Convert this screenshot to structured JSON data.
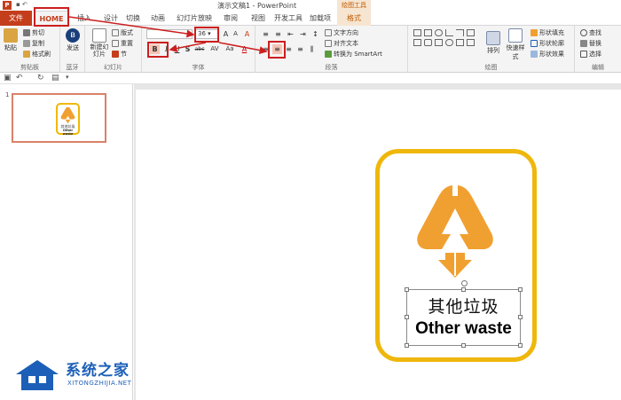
{
  "window": {
    "title": "演示文稿1 - PowerPoint",
    "contextual_tools_label": "绘图工具"
  },
  "tabs": [
    {
      "label": "文件"
    },
    {
      "label": "HOME"
    },
    {
      "label": "插入"
    },
    {
      "label": "设计"
    },
    {
      "label": "切换"
    },
    {
      "label": "动画"
    },
    {
      "label": "幻灯片放映"
    },
    {
      "label": "审阅"
    },
    {
      "label": "视图"
    },
    {
      "label": "开发工具"
    },
    {
      "label": "加载项"
    },
    {
      "label": "格式"
    }
  ],
  "ribbon": {
    "clipboard": {
      "label": "剪贴板",
      "paste": "粘贴",
      "cut": "剪切",
      "copy": "复制",
      "format_painter": "格式刷"
    },
    "bluetooth": {
      "label": "蓝牙",
      "send": "发送"
    },
    "slides": {
      "label": "幻灯片",
      "new_slide": "新建幻灯片",
      "layout": "版式",
      "reset": "重置",
      "section": "节"
    },
    "font": {
      "label": "字体",
      "size": "36",
      "grow": "A",
      "shrink": "A",
      "clear": "A",
      "bold": "B",
      "italic": "I",
      "underline": "U",
      "shadow": "S",
      "strike": "abc",
      "spacing": "AV",
      "case": "Aa",
      "color": "A"
    },
    "paragraph": {
      "label": "段落",
      "text_direction": "文字方向",
      "align_text": "对齐文本",
      "smartart": "转换为 SmartArt"
    },
    "drawing": {
      "label": "绘图",
      "arrange": "排列",
      "quick_styles": "快速样式",
      "shape_fill": "形状填充",
      "shape_outline": "形状轮廓",
      "shape_effects": "形状效果"
    },
    "editing": {
      "label": "编辑",
      "find": "查找",
      "replace": "替换",
      "select": "选择"
    }
  },
  "slide_panel": {
    "slide_number": "1",
    "thumb_cn": "其他垃圾",
    "thumb_en": "Other waste"
  },
  "slide": {
    "cn_text": "其他垃圾",
    "en_text": "Other waste"
  },
  "watermark": {
    "name": "系统之家",
    "url": "XITONGZHIJIA.NET"
  },
  "colors": {
    "accent": "#c43e1c",
    "card_border": "#efb70b",
    "logo": "#f0a030",
    "annotation": "#cc1f1f",
    "watermark": "#1c5fb8"
  }
}
